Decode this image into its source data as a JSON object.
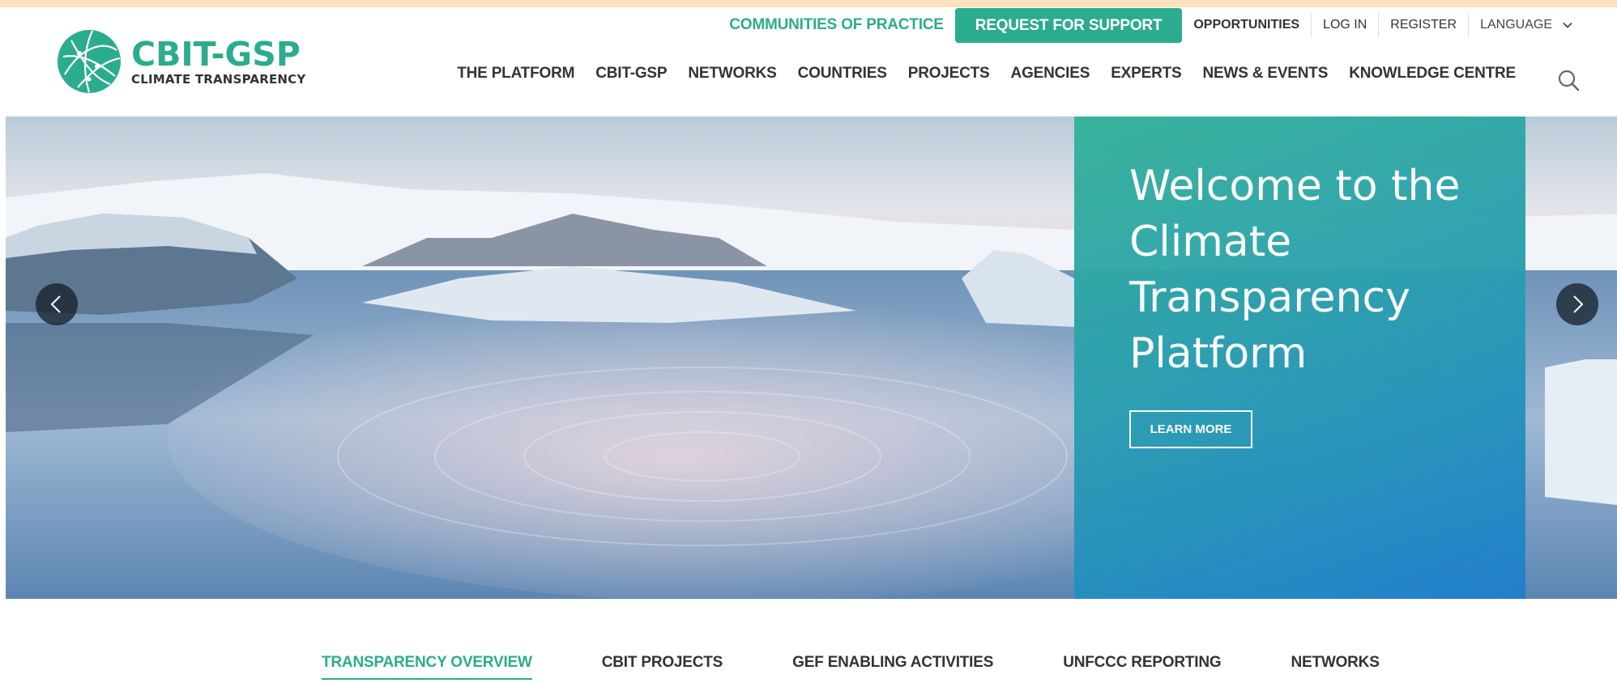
{
  "logo": {
    "title": "CBIT-GSP",
    "subtitle": "CLIMATE TRANSPARENCY",
    "icon": "globe-icon"
  },
  "utility_nav": {
    "communities": "COMMUNITIES OF PRACTICE",
    "request": "REQUEST FOR SUPPORT",
    "opportunities": "OPPORTUNITIES",
    "login": "LOG IN",
    "register": "REGISTER",
    "language": "LANGUAGE"
  },
  "main_nav": {
    "items": [
      "THE PLATFORM",
      "CBIT-GSP",
      "NETWORKS",
      "COUNTRIES",
      "PROJECTS",
      "AGENCIES",
      "EXPERTS",
      "NEWS & EVENTS",
      "KNOWLEDGE CENTRE"
    ]
  },
  "hero": {
    "title": "Welcome to the Climate Transparency Platform",
    "button": "LEARN MORE"
  },
  "tabs": {
    "items": [
      "TRANSPARENCY OVERVIEW",
      "CBIT PROJECTS",
      "GEF ENABLING ACTIVITIES",
      "UNFCCC REPORTING",
      "NETWORKS"
    ],
    "active": "TRANSPARENCY OVERVIEW"
  },
  "colors": {
    "brand": "#2bac8e",
    "panel_end": "#1f7fcc",
    "top_strip": "#fbe3bd"
  }
}
